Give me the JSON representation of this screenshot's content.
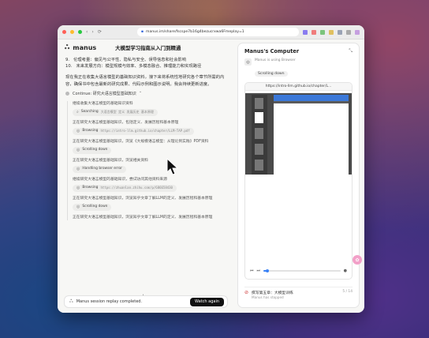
{
  "browser": {
    "url": "manus.im/share/fscspe7b16g4bezucrxwa6Fmeplay=1",
    "nav": [
      "‹",
      "›",
      "⟳",
      "⌂"
    ]
  },
  "chat": {
    "brand": "manus",
    "task_title": "大模型学习指南从入门到精通",
    "list_items": [
      {
        "num": "9.",
        "text": "伦理考量：偏见与公平性、隐私与安全、误导信息和社会影响"
      },
      {
        "num": "10.",
        "text": "未来发展方向：模型规模与效率、多模态融合、推理能力和实现路径"
      }
    ],
    "intro": "现在我正在收集大语言模型的基础知识资料，接下来将系统性地研究各个章节所需的内容，确保书中包含最新的研究成果、代码示例和图示说明。我会持续更新进度。",
    "step_title": "Continue: 研究大语言模型基础知识",
    "step_items": [
      {
        "type": "text",
        "text": "继续收集大语言模型的基础知识资料"
      },
      {
        "type": "tool",
        "icon": "⌕",
        "label": "Searching",
        "arg": "大语言模型 定义 发展历史 基本原理"
      },
      {
        "type": "text",
        "text": "正在研究大语言模型基础知识，包括定义、发展历程和基本原理"
      },
      {
        "type": "tool",
        "icon": "◎",
        "label": "Browsing",
        "arg": "https://intro-llm.github.io/chapter/LLM-TAP.pdf"
      },
      {
        "type": "text",
        "text": "正在研究大语言模型基础知识，浏览《大规模语言模型：从理论到实践》PDF资料"
      },
      {
        "type": "tool",
        "icon": "◎",
        "label": "Scrolling down",
        "arg": ""
      },
      {
        "type": "text",
        "text": "正在研究大语言模型基础知识，浏览相关资料"
      },
      {
        "type": "tool",
        "icon": "◎",
        "label": "Handling browser error",
        "arg": ""
      },
      {
        "type": "text",
        "text": "继续研究大语言模型的基础知识，尝试访问其他资料来源"
      },
      {
        "type": "tool",
        "icon": "◎",
        "label": "Browsing",
        "arg": "https://zhuanlan.zhihu.com/p/686658430"
      },
      {
        "type": "text",
        "text": "正在研究大语言模型基础知识，浏览知乎文章了解LLM的定义、发展历程和基本原理"
      },
      {
        "type": "tool",
        "icon": "◎",
        "label": "Scrolling down",
        "arg": ""
      },
      {
        "type": "text",
        "text": "正在研究大语言模型基础知识，浏览知乎文章了解LLM的定义、发展历程和基本原理"
      }
    ],
    "replay_text": "Manus session replay completed.",
    "watch_label": "Watch again"
  },
  "computer": {
    "title": "Manus's Computer",
    "agent_status": "Manus is using Browser",
    "agent_action": "Scrolling down",
    "frame_url": "https://intro-llm.github.io/chapter/L...",
    "task_name": "撰写第五章：大模型训练",
    "task_status": "Manus has stopped",
    "task_count": "5 / 14",
    "progress": 0.05
  },
  "colors": {
    "accent": "#3b82f6",
    "watch_bg": "#111111",
    "pdf_header": "#3b78d8",
    "pink": "#f2a0c8"
  }
}
